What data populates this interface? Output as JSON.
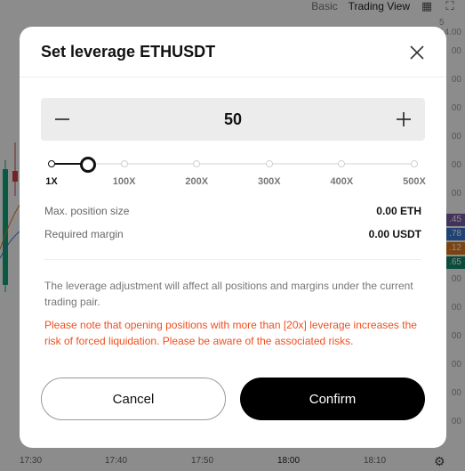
{
  "background": {
    "header": {
      "basic_tab": "Basic",
      "tradingview_tab": "Trading View"
    },
    "price_labels": [
      "5 14.00",
      "00",
      "00",
      "00",
      "00",
      "00",
      "00",
      "00",
      "00",
      "00",
      "00",
      "00",
      "00",
      "00",
      "00"
    ],
    "tags": [
      {
        "text": ".45",
        "color": "#7b5ea7"
      },
      {
        "text": ".78",
        "color": "#3a7bd5"
      },
      {
        "text": ".12",
        "color": "#e07b1f"
      },
      {
        "text": ".65",
        "color": "#138a6b"
      }
    ],
    "time_labels": [
      "17:30",
      "17:40",
      "17:50",
      "18:00",
      "18:10"
    ]
  },
  "modal": {
    "title": "Set leverage ETHUSDT",
    "stepper_value": "50",
    "slider": {
      "ticks": [
        "1X",
        "100X",
        "200X",
        "300X",
        "400X",
        "500X"
      ],
      "value": 50,
      "max": 500
    },
    "info": [
      {
        "label": "Max. position size",
        "value": "0.00 ETH"
      },
      {
        "label": "Required margin",
        "value": "0.00 USDT"
      }
    ],
    "note": "The leverage adjustment will affect all positions and margins under the current trading pair.",
    "warning": "Please note that opening positions with more than [20x] leverage increases the risk of forced liquidation. Please be aware of the associated risks.",
    "cancel_label": "Cancel",
    "confirm_label": "Confirm"
  }
}
